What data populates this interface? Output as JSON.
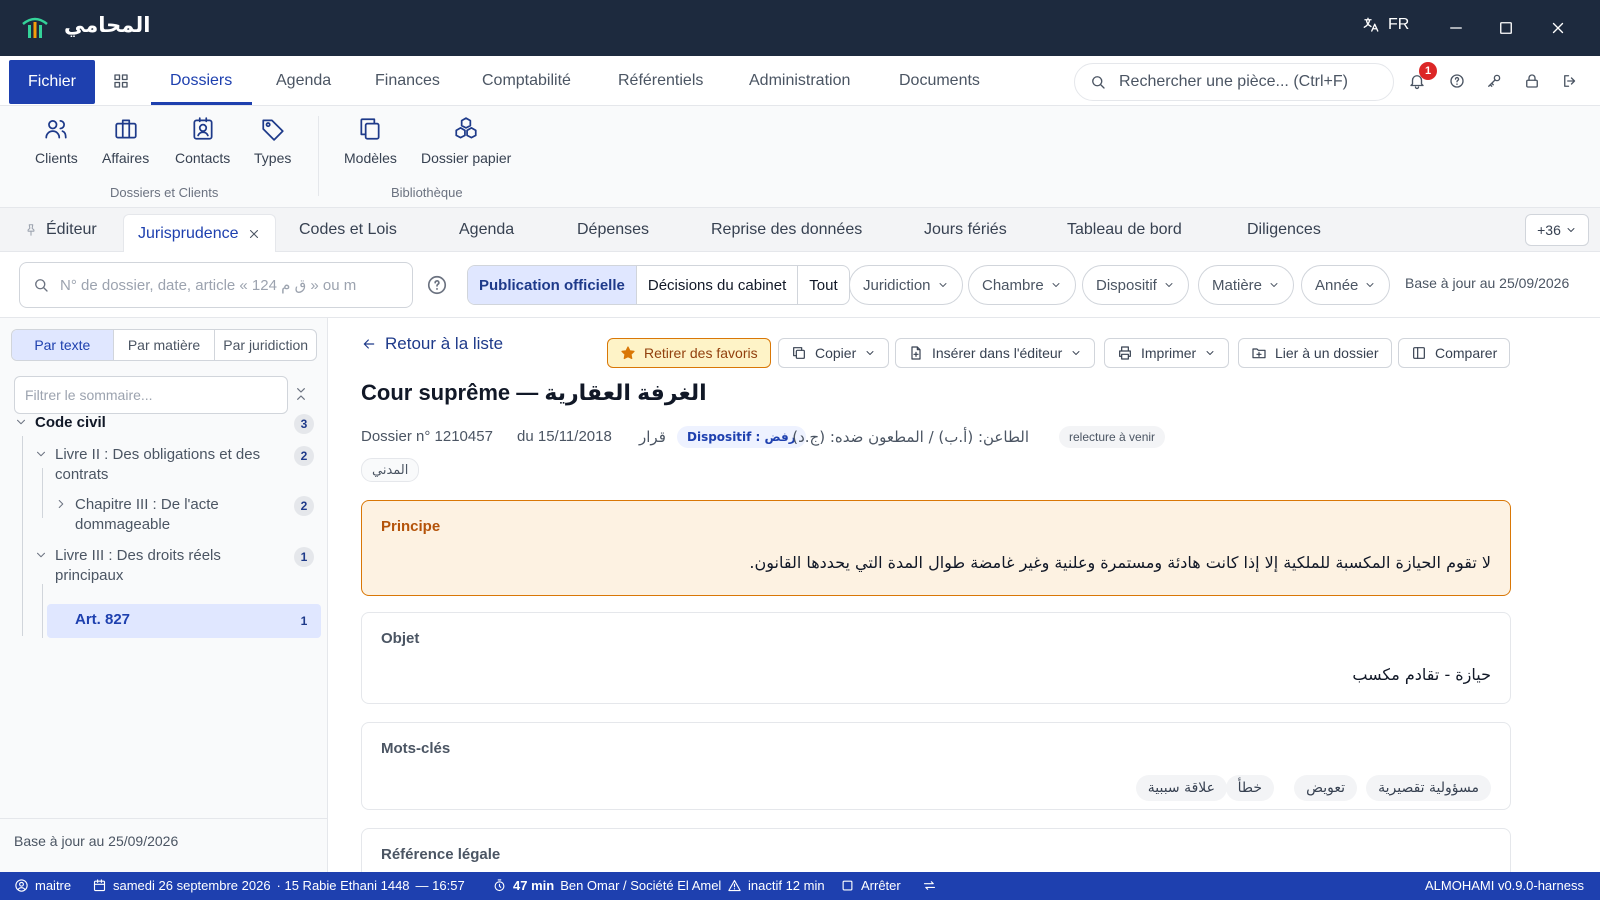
{
  "titlebar": {
    "app_name": "المحامي",
    "lang": "FR"
  },
  "menu": {
    "fichier": "Fichier",
    "items": [
      "Dossiers",
      "Agenda",
      "Finances",
      "Comptabilité",
      "Référentiels",
      "Administration",
      "Documents"
    ],
    "search_placeholder": "Rechercher une pièce... (Ctrl+F)",
    "notifications": "1"
  },
  "ribbon": {
    "buttons": [
      "Clients",
      "Affaires",
      "Contacts",
      "Types",
      "Modèles",
      "Dossier papier"
    ],
    "groups": [
      "Dossiers et Clients",
      "Bibliothèque"
    ]
  },
  "tabs": {
    "items": [
      "Éditeur",
      "Jurisprudence",
      "Codes et Lois",
      "Agenda",
      "Dépenses",
      "Reprise des données",
      "Jours fériés",
      "Tableau de bord",
      "Diligences"
    ],
    "more": "+36"
  },
  "filters": {
    "search_placeholder": "N° de dossier, date, article « 124 ق م » ou m",
    "segments": [
      "Publication officielle",
      "Décisions du cabinet",
      "Tout"
    ],
    "dropdowns": [
      "Juridiction",
      "Chambre",
      "Dispositif",
      "Matière",
      "Année"
    ],
    "base_date": "Base à jour au 25/09/2026"
  },
  "sidebar": {
    "tabs": [
      "Par texte",
      "Par matière",
      "Par juridiction"
    ],
    "filter_placeholder": "Filtrer le sommaire...",
    "tree": [
      {
        "label": "Code civil",
        "count": "3"
      },
      {
        "label": "Livre II : Des obligations et des",
        "label2": "contrats",
        "count": "2"
      },
      {
        "label": "Chapitre III : De l'acte",
        "label2": "dommageable",
        "count": "2"
      },
      {
        "label": "Livre III : Des droits réels",
        "label2": "principaux",
        "count": "1"
      },
      {
        "label": "Art. 827",
        "count": "1"
      }
    ],
    "footer": "Base à jour au 25/09/2026"
  },
  "decision": {
    "back": "Retour à la liste",
    "actions": [
      "Retirer des favoris",
      "Copier",
      "Insérer dans l'éditeur",
      "Imprimer",
      "Lier à un dossier",
      "Comparer"
    ],
    "title": "Cour suprême — الغرفة العقارية",
    "dossier": "Dossier n° 1210457",
    "date": "du 15/11/2018",
    "type": "قرار",
    "dispositif": "Dispositif : رفض",
    "parties": "الطاعن: (أ.ب) / المطعون ضده: (ج.د)",
    "status": "relecture à venir",
    "domain": "المدني",
    "principe_label": "Principe",
    "principe_text": "لا تقوم الحيازة المكسبة للملكية إلا إذا كانت هادئة ومستمرة وعلنية وغير غامضة طوال المدة التي يحددها القانون.",
    "objet_label": "Objet",
    "objet_text": "حيازة - تقادم مكسب",
    "keywords_label": "Mots-clés",
    "keywords": [
      "مسؤولية تقصيرية",
      "تعويض",
      "خطأ",
      "علاقة سببية"
    ],
    "reference_label": "Référence légale"
  },
  "status": {
    "user": "maitre",
    "date": "samedi 26 septembre 2026",
    "hijri": "· 15 Rabie Ethani 1448",
    "time": "— 16:57",
    "timer": "47 min",
    "client": "Ben Omar / Société El Amel",
    "inactive": "inactif 12 min",
    "stop": "Arrêter",
    "version": "ALMOHAMI v0.9.0-harness"
  },
  "colors": {
    "titlebar": "#1d2a3e",
    "accent": "#1e40af",
    "favorite": "#d97706",
    "principe_bg": "#fdf2e2"
  }
}
